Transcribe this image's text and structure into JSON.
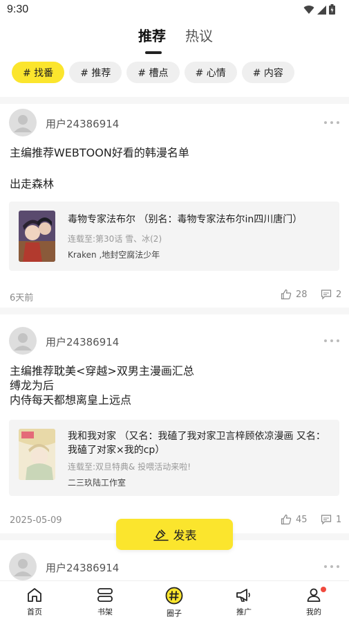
{
  "status_bar": {
    "time": "9:30"
  },
  "top_tabs": {
    "active": "推荐",
    "inactive": "热议"
  },
  "tags": [
    "# 找番",
    "# 推荐",
    "# 槽点",
    "# 心情",
    "# 内容"
  ],
  "posts": [
    {
      "username": "用户24386914",
      "text_lines": [
        "主编推荐WEBTOON好看的韩漫名单",
        "出走森林"
      ],
      "card": {
        "title": "毒物专家法布尔 （别名：毒物专家法布尔in四川唐门）",
        "sub": "连载至:第30话 雪、冰(2)",
        "author": "Kraken ,地封空腐法少年"
      },
      "time": "6天前",
      "likes": "28",
      "comments": "2"
    },
    {
      "username": "用户24386914",
      "text_lines": [
        "主编推荐耽美<穿越>双男主漫画汇总",
        "缚龙为后",
        "内侍每天都想离皇上远点"
      ],
      "card": {
        "title": "我和我对家 （又名：我磕了我对家卫言梓顾依凉漫画 又名：我磕了对家×我的cp）",
        "sub": "连载至:双旦特典& 投喂活动来啦!",
        "author": "二三玖陆工作室"
      },
      "time": "2025-05-09",
      "likes": "45",
      "comments": "1"
    },
    {
      "username": "用户24386914"
    }
  ],
  "publish_button": {
    "label": "发表"
  },
  "bottom_nav": [
    {
      "label": "首页",
      "icon": "home-icon"
    },
    {
      "label": "书架",
      "icon": "bookshelf-icon"
    },
    {
      "label": "圈子",
      "icon": "circle-hash-icon"
    },
    {
      "label": "推广",
      "icon": "megaphone-icon"
    },
    {
      "label": "我的",
      "icon": "profile-icon"
    }
  ],
  "colors": {
    "accent": "#fbe52d",
    "badge": "#f04a3e"
  }
}
